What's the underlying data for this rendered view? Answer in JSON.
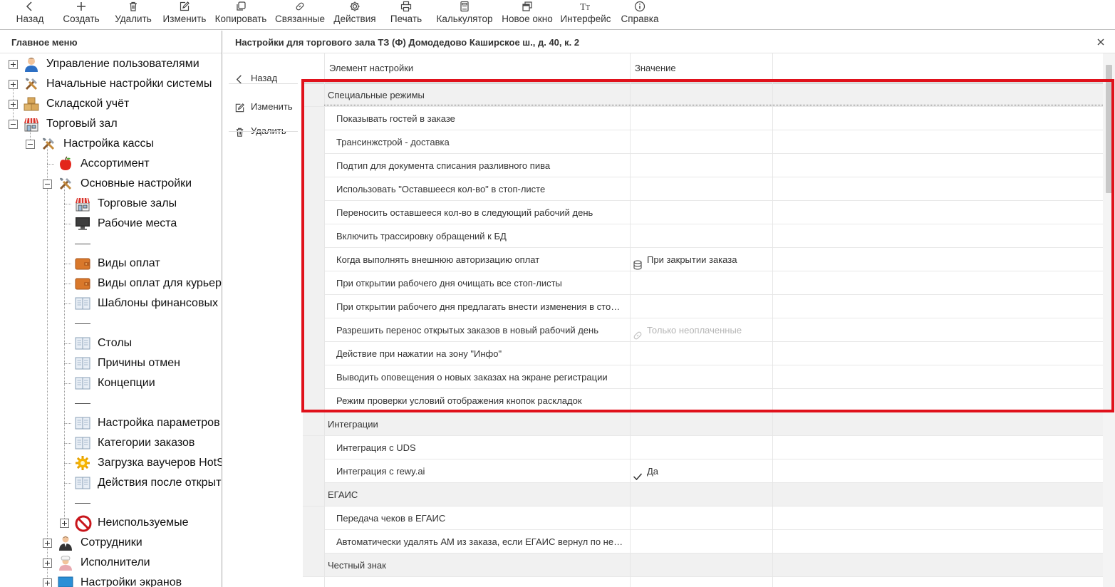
{
  "toolbar": {
    "buttons": [
      {
        "label": "Назад",
        "icon": "chevron-left-icon"
      },
      {
        "label": "Создать",
        "icon": "plus-icon"
      },
      {
        "label": "Удалить",
        "icon": "trash-icon"
      },
      {
        "label": "Изменить",
        "icon": "edit-icon"
      },
      {
        "label": "Копировать",
        "icon": "copy-icon"
      },
      {
        "label": "Связанные",
        "icon": "link-icon"
      },
      {
        "label": "Действия",
        "icon": "gear-icon"
      },
      {
        "label": "Печать",
        "icon": "printer-icon"
      },
      {
        "label": "Калькулятор",
        "icon": "calculator-icon"
      },
      {
        "label": "Новое окно",
        "icon": "new-window-icon"
      },
      {
        "label": "Интерфейс",
        "icon": "font-icon"
      },
      {
        "label": "Справка",
        "icon": "info-icon"
      }
    ]
  },
  "sidebar": {
    "title": "Главное меню",
    "items": [
      {
        "label": "Управление пользователями",
        "icon": "user-icon",
        "expander": "plus"
      },
      {
        "label": "Начальные настройки системы",
        "icon": "tools-icon",
        "expander": "plus"
      },
      {
        "label": "Складской учёт",
        "icon": "boxes-icon",
        "expander": "plus"
      },
      {
        "label": "Торговый зал",
        "icon": "store-icon",
        "expander": "minus"
      },
      {
        "label": "Настройка кассы",
        "icon": "tools-icon",
        "expander": "minus"
      },
      {
        "label": "Ассортимент",
        "icon": "apple-icon"
      },
      {
        "label": "Основные настройки",
        "icon": "tools-icon",
        "expander": "minus"
      },
      {
        "label": "Торговые залы",
        "icon": "store-icon"
      },
      {
        "label": "Рабочие места",
        "icon": "monitor-icon"
      },
      {
        "label": "",
        "icon": "separator"
      },
      {
        "label": "Виды оплат",
        "icon": "wallet-icon"
      },
      {
        "label": "Виды оплат для курьеров",
        "icon": "wallet-icon"
      },
      {
        "label": "Шаблоны финансовых операций",
        "icon": "book-icon"
      },
      {
        "label": "",
        "icon": "separator"
      },
      {
        "label": "Столы",
        "icon": "book-icon"
      },
      {
        "label": "Причины отмен",
        "icon": "book-icon"
      },
      {
        "label": "Концепции",
        "icon": "book-icon"
      },
      {
        "label": "",
        "icon": "separator"
      },
      {
        "label": "Настройка параметров",
        "icon": "book-icon"
      },
      {
        "label": "Категории заказов",
        "icon": "book-icon"
      },
      {
        "label": "Загрузка ваучеров HotSpot",
        "icon": "sun-gear-icon"
      },
      {
        "label": "Действия после открытия дня",
        "icon": "book-icon"
      },
      {
        "label": "",
        "icon": "separator"
      },
      {
        "label": "Неиспользуемые",
        "icon": "forbidden-icon",
        "expander": "plus"
      },
      {
        "label": "Сотрудники",
        "icon": "person-suit-icon",
        "expander": "plus"
      },
      {
        "label": "Исполнители",
        "icon": "chef-icon",
        "expander": "plus"
      },
      {
        "label": "Настройки экранов",
        "icon": "screen-icon",
        "expander": "plus"
      }
    ]
  },
  "content": {
    "title": "Настройки для торгового зала ТЗ (Ф) Домодедово Каширское ш., д. 40, к. 2",
    "actions": [
      {
        "label": "Назад",
        "icon": "chevron-left-icon"
      },
      {
        "label": "Изменить",
        "icon": "edit-icon"
      },
      {
        "label": "Удалить",
        "icon": "trash-icon"
      }
    ],
    "columns": {
      "setting": "Элемент настройки",
      "value": "Значение"
    },
    "rows": [
      {
        "type": "group",
        "label": "Специальные режимы"
      },
      {
        "type": "item",
        "label": "Показывать гостей в заказе",
        "value": ""
      },
      {
        "type": "item",
        "label": "Трансинжстрой - доставка",
        "value": ""
      },
      {
        "type": "item",
        "label": "Подтип для документа списания разливного пива",
        "value": ""
      },
      {
        "type": "item",
        "label": "Использовать \"Оставшееся кол-во\" в стоп-листе",
        "value": ""
      },
      {
        "type": "item",
        "label": "Переносить оставшееся кол-во в следующий рабочий день",
        "value": ""
      },
      {
        "type": "item",
        "label": "Включить трассировку обращений к БД",
        "value": ""
      },
      {
        "type": "item",
        "label": "Когда выполнять внешнюю авторизацию оплат",
        "value": "При закрытии заказа",
        "value_icon": "database-icon"
      },
      {
        "type": "item",
        "label": "При открытии рабочего дня очищать все стоп-листы",
        "value": ""
      },
      {
        "type": "item",
        "label": "При открытии рабочего дня предлагать внести изменения в стоп-листы",
        "value": ""
      },
      {
        "type": "item",
        "label": "Разрешить перенос открытых заказов в новый рабочий день",
        "value": "Только неоплаченные",
        "value_icon": "link-icon",
        "muted": true
      },
      {
        "type": "item",
        "label": "Действие при нажатии на зону \"Инфо\"",
        "value": ""
      },
      {
        "type": "item",
        "label": "Выводить оповещения о новых заказах на экране регистрации",
        "value": ""
      },
      {
        "type": "item",
        "label": "Режим проверки условий отображения кнопок раскладок",
        "value": ""
      },
      {
        "type": "group",
        "label": "Интеграции"
      },
      {
        "type": "item",
        "label": "Интеграция с UDS",
        "value": ""
      },
      {
        "type": "item",
        "label": "Интеграция с rewy.ai",
        "value": "Да",
        "value_icon": "check-icon"
      },
      {
        "type": "group",
        "label": "ЕГАИС"
      },
      {
        "type": "item",
        "label": "Передача чеков в ЕГАИС",
        "value": ""
      },
      {
        "type": "item",
        "label": "Автоматически удалять АМ из заказа, если ЕГАИС вернул по нему ошибку",
        "value": ""
      },
      {
        "type": "group",
        "label": "Честный знак"
      }
    ]
  },
  "colors": {
    "highlight": "#e0111b",
    "group_bg": "#f1f1f1"
  }
}
